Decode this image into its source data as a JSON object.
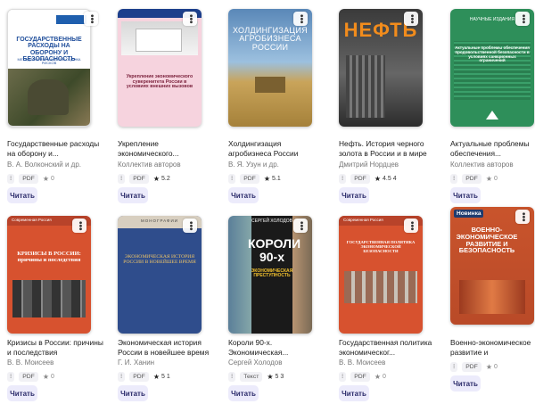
{
  "read_label": "Читать",
  "books": [
    {
      "title": "Государственные расходы на оборону и...",
      "author": "В. А. Волконский и др.",
      "format": "PDF",
      "rating": "0",
      "cover_text": "ГОСУДАРСТВЕННЫЕ РАСХОДЫ НА ОБОРОНУ И БЕЗОПАСНОСТЬ",
      "cover_sub": "МЕТОДОЛОГИЯ, АНАЛИЗ И ОЦЕНКА РИСКОВ"
    },
    {
      "title": "Укрепление экономического...",
      "author": "Коллектив авторов",
      "format": "PDF",
      "rating": "5.2",
      "cover_text": "Укрепление экономического суверенитета России в условиях внешних вызовов"
    },
    {
      "title": "Холдингизация агробизнеса России",
      "author": "В. Я. Узун и др.",
      "format": "PDF",
      "rating": "5.1",
      "cover_text": "ХОЛДИНГИЗАЦИЯ АГРОБИЗНЕСА РОССИИ"
    },
    {
      "title": "Нефть. История черного золота в России и в мире",
      "author": "Дмитрий Нордцев",
      "format": "PDF",
      "rating": "4.5 4",
      "cover_text": "НЕФТЬ"
    },
    {
      "title": "Актуальные проблемы обеспечения...",
      "author": "Коллектив авторов",
      "format": "PDF",
      "rating": "0",
      "cover_top": "НАУЧНЫЕ ИЗДАНИЯ",
      "cover_text": "Актуальные проблемы обеспечения продовольственной безопасности в условиях санкционных ограничений"
    },
    {
      "title": "Кризисы в России: причины и последствия",
      "author": "В. В. Моисеев",
      "format": "PDF",
      "rating": "0",
      "cover_top": "Современная Россия",
      "cover_text": "КРИЗИСЫ В РОССИИ: причины и последствия"
    },
    {
      "title": "Экономическая история России в новейшее время",
      "author": "Г. И. Ханин",
      "format": "PDF",
      "rating": "5 1",
      "cover_top": "МОНОГРАФИИ",
      "cover_text": "ЭКОНОМИЧЕСКАЯ ИСТОРИЯ РОССИИ В НОВЕЙШЕЕ ВРЕМЯ"
    },
    {
      "title": "Короли 90-х. Экономическая...",
      "author": "Сергей Холодов",
      "format": "Текст",
      "rating": "5 3",
      "cover_top": "СЕРГЕЙ ХОЛОДОВ",
      "cover_text": "КОРОЛИ 90-х",
      "cover_sub": "ЭКОНОМИЧЕСКАЯ ПРЕСТУПНОСТЬ"
    },
    {
      "title": "Государственная политика экономическог...",
      "author": "В. В. Моисеев",
      "format": "PDF",
      "rating": "0",
      "cover_top": "Современная Россия",
      "cover_text": "ГОСУДАРСТВЕННАЯ ПОЛИТИКА ЭКОНОМИЧЕСКОЙ БЕЗОПАСНОСТИ"
    },
    {
      "title": "Военно-экономическое развитие и безопасность",
      "author": "",
      "format": "PDF",
      "rating": "0",
      "badge": "Новинка",
      "cover_text": "ВОЕННО-ЭКОНОМИЧЕСКОЕ РАЗВИТИЕ И БЕЗОПАСНОСТЬ"
    }
  ]
}
